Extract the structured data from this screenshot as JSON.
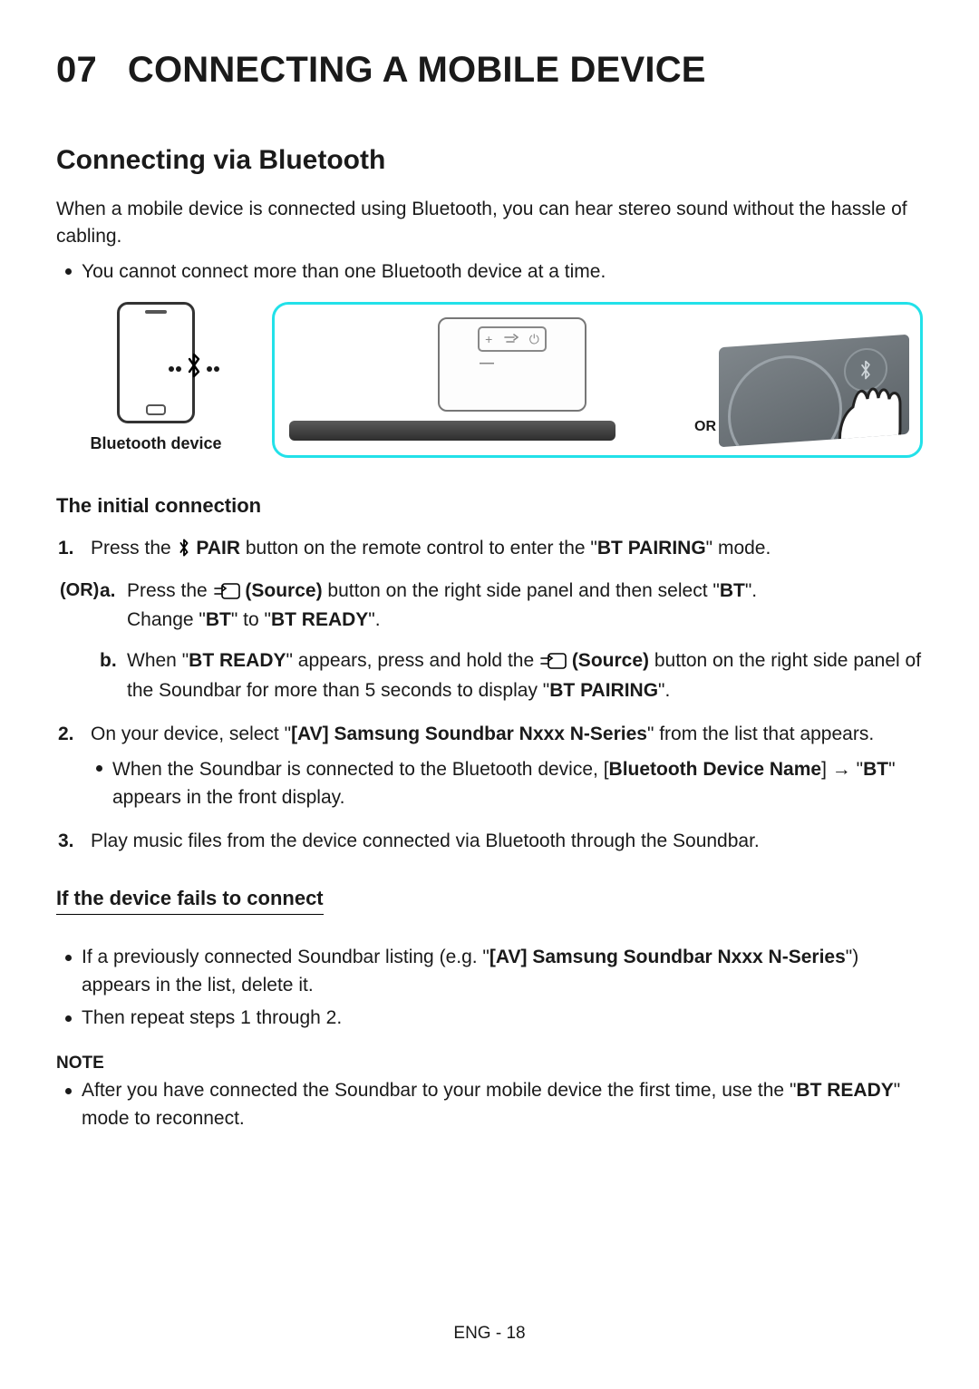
{
  "chapter": {
    "number": "07",
    "title": "CONNECTING A MOBILE DEVICE"
  },
  "section_title": "Connecting via Bluetooth",
  "intro_text": "When a mobile device is connected using Bluetooth, you can hear stereo sound without the hassle of cabling.",
  "intro_bullet": "You cannot connect more than one Bluetooth device at a time.",
  "diagram": {
    "left_label": "Bluetooth device",
    "or_label": "OR"
  },
  "initial_heading": "The initial connection",
  "step1": {
    "num": "1.",
    "pre": "Press the ",
    "pair_label": " PAIR",
    "mid": " button on the remote control to enter the \"",
    "mode": "BT PAIRING",
    "post": "\" mode."
  },
  "or_label_side": "(OR)",
  "step1a": {
    "lt": "a.",
    "pre": "Press the ",
    "src_label": " (Source)",
    "mid": " button on the right side panel and then select \"",
    "bt": "BT",
    "post": "\".",
    "line2_pre": "Change \"",
    "line2_bt": "BT",
    "line2_mid": "\" to \"",
    "line2_ready": "BT READY",
    "line2_post": "\"."
  },
  "step1b": {
    "lt": "b.",
    "pre": "When \"",
    "ready": "BT READY",
    "mid": "\" appears, press and hold the ",
    "src_label": " (Source)",
    "post": " button on the right side panel of the Soundbar for more than 5 seconds to display \"",
    "pairing": "BT PAIRING",
    "end": "\"."
  },
  "step2": {
    "num": "2.",
    "pre": "On your device, select \"",
    "dev": "[AV] Samsung Soundbar Nxxx N-Series",
    "post": "\" from the list that appears.",
    "sub_pre": "When the Soundbar is connected to the Bluetooth device, [",
    "sub_name": "Bluetooth Device Name",
    "sub_mid": "] → \"",
    "sub_bt": "BT",
    "sub_post": "\" appears in the front display."
  },
  "step3": {
    "num": "3.",
    "text": "Play music files from the device connected via Bluetooth through the Soundbar."
  },
  "fail_heading": "If the device fails to connect",
  "fail_b1_pre": "If a previously connected Soundbar listing (e.g. \"",
  "fail_b1_dev": "[AV] Samsung Soundbar Nxxx N-Series",
  "fail_b1_post": "\") appears in the list, delete it.",
  "fail_b2": "Then repeat steps 1 through 2.",
  "note_head": "NOTE",
  "note_pre": "After you have connected the Soundbar to your mobile device the first time, use the \"",
  "note_ready": "BT READY",
  "note_post": "\" mode to reconnect.",
  "footer": "ENG - 18"
}
